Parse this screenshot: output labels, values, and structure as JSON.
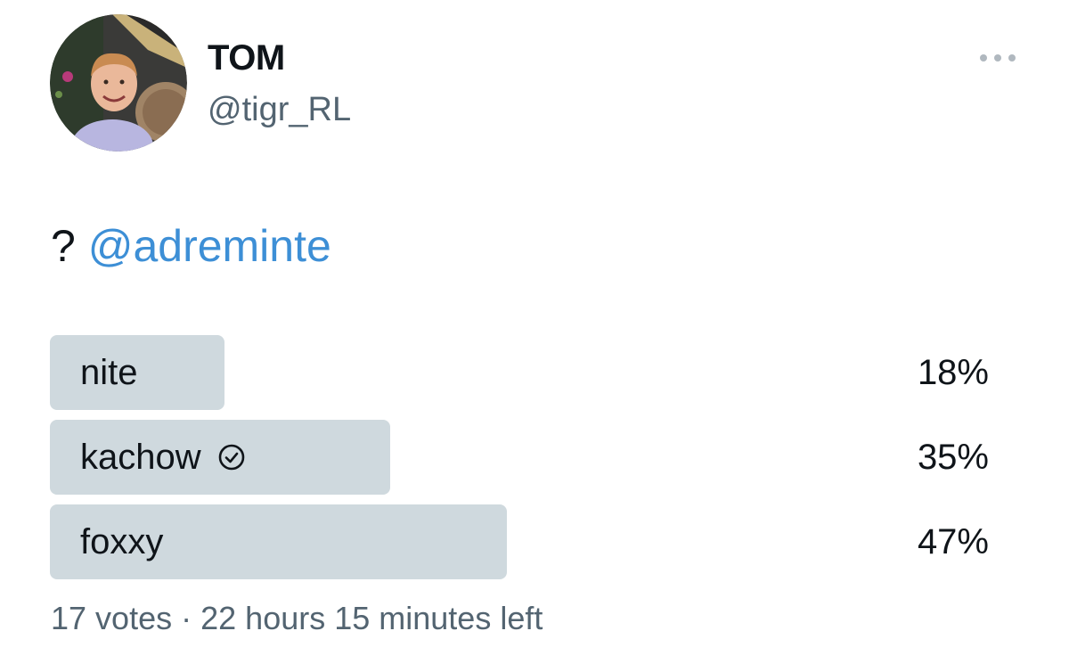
{
  "tweet": {
    "author": {
      "display_name": "TOM",
      "handle": "@tigr_RL"
    },
    "more_icon": "more-horizontal-icon",
    "text_prefix": "? ",
    "mention": "@adreminte"
  },
  "poll": {
    "options": [
      {
        "label": "nite",
        "percent_text": "18%",
        "fraction": 0.18,
        "selected": false
      },
      {
        "label": "kachow",
        "percent_text": "35%",
        "fraction": 0.35,
        "selected": true,
        "icon": "check-circle-icon"
      },
      {
        "label": "foxxy",
        "percent_text": "47%",
        "fraction": 0.47,
        "selected": false
      }
    ],
    "votes": "17 votes",
    "separator": "·",
    "time_left": "22 hours 15 minutes left"
  },
  "colors": {
    "text": "#0f1419",
    "secondary_text": "#536471",
    "link": "#3d8fd6",
    "poll_bar": "#cfd9de"
  }
}
